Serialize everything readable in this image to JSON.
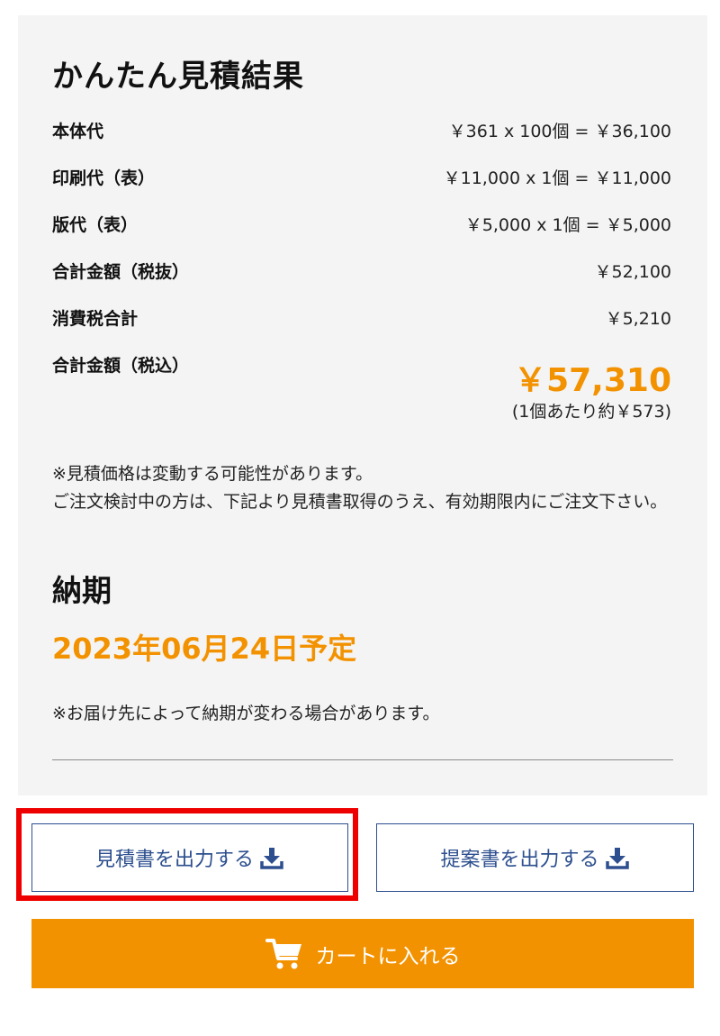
{
  "estimate": {
    "title": "かんたん見積結果",
    "rows": [
      {
        "label": "本体代",
        "value": "￥361 x 100個 = ￥36,100"
      },
      {
        "label": "印刷代（表）",
        "value": "￥11,000 x 1個 = ￥11,000"
      },
      {
        "label": "版代（表）",
        "value": "￥5,000 x 1個 = ￥5,000"
      },
      {
        "label": "合計金額（税抜）",
        "value": "￥52,100"
      },
      {
        "label": "消費税合計",
        "value": "￥5,210"
      }
    ],
    "total_label": "合計金額（税込）",
    "total_amount": "￥57,310",
    "per_unit_note": "(1個あたり約￥573)",
    "notice_line1": "※見積価格は変動する可能性があります。",
    "notice_line2": "ご注文検討中の方は、下記より見積書取得のうえ、有効期限内にご注文下さい。"
  },
  "delivery": {
    "heading": "納期",
    "date": "2023年06月24日予定",
    "note": "※お届け先によって納期が変わる場合があります。"
  },
  "buttons": {
    "quote_output": "見積書を出力する",
    "proposal_output": "提案書を出力する",
    "add_to_cart": "カートに入れる"
  },
  "colors": {
    "accent_orange": "#f39200",
    "button_blue": "#2d4f8f",
    "highlight_red": "#ee0000",
    "panel_bg": "#f4f4f4"
  },
  "icons": {
    "download": "download-icon",
    "cart": "cart-icon"
  }
}
